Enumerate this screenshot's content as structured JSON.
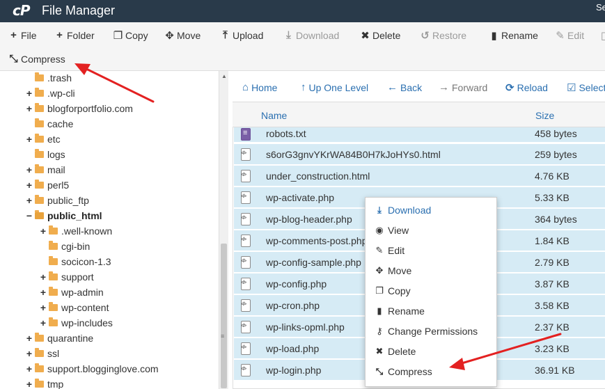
{
  "header": {
    "logo": "cP",
    "title": "File Manager",
    "right_text": "Se"
  },
  "toolbar": {
    "file": "File",
    "folder": "Folder",
    "copy": "Copy",
    "move": "Move",
    "upload": "Upload",
    "download": "Download",
    "delete": "Delete",
    "restore": "Restore",
    "rename": "Rename",
    "edit": "Edit",
    "compress": "Compress"
  },
  "tree": [
    {
      "label": ".trash",
      "expander": ""
    },
    {
      "label": ".wp-cli",
      "expander": "+"
    },
    {
      "label": "blogforportfolio.com",
      "expander": "+"
    },
    {
      "label": "cache",
      "expander": ""
    },
    {
      "label": "etc",
      "expander": "+"
    },
    {
      "label": "logs",
      "expander": ""
    },
    {
      "label": "mail",
      "expander": "+"
    },
    {
      "label": "perl5",
      "expander": "+"
    },
    {
      "label": "public_ftp",
      "expander": "+"
    },
    {
      "label": "public_html",
      "expander": "−"
    },
    {
      "label": ".well-known",
      "expander": "+"
    },
    {
      "label": "cgi-bin",
      "expander": ""
    },
    {
      "label": "socicon-1.3",
      "expander": ""
    },
    {
      "label": "support",
      "expander": "+"
    },
    {
      "label": "wp-admin",
      "expander": "+"
    },
    {
      "label": "wp-content",
      "expander": "+"
    },
    {
      "label": "wp-includes",
      "expander": "+"
    },
    {
      "label": "quarantine",
      "expander": "+"
    },
    {
      "label": "ssl",
      "expander": "+"
    },
    {
      "label": "support.blogginglove.com",
      "expander": "+"
    },
    {
      "label": "tmp",
      "expander": "+"
    }
  ],
  "nav": {
    "home": "Home",
    "up": "Up One Level",
    "back": "Back",
    "forward": "Forward",
    "reload": "Reload",
    "select_all": "Select All"
  },
  "columns": {
    "name": "Name",
    "size": "Size"
  },
  "files": [
    {
      "name": "robots.txt",
      "size": "458 bytes",
      "icon": "text-file-icon"
    },
    {
      "name": "s6orG3gnvYKrWA84B0H7kJoHYs0.html",
      "size": "259 bytes",
      "icon": "code-file-icon"
    },
    {
      "name": "under_construction.html",
      "size": "4.76 KB",
      "icon": "code-file-icon"
    },
    {
      "name": "wp-activate.php",
      "size": "5.33 KB",
      "icon": "code-file-icon"
    },
    {
      "name": "wp-blog-header.php",
      "size": "364 bytes",
      "icon": "code-file-icon"
    },
    {
      "name": "wp-comments-post.php",
      "size": "1.84 KB",
      "icon": "code-file-icon"
    },
    {
      "name": "wp-config-sample.php",
      "size": "2.79 KB",
      "icon": "code-file-icon"
    },
    {
      "name": "wp-config.php",
      "size": "3.87 KB",
      "icon": "code-file-icon"
    },
    {
      "name": "wp-cron.php",
      "size": "3.58 KB",
      "icon": "code-file-icon"
    },
    {
      "name": "wp-links-opml.php",
      "size": "2.37 KB",
      "icon": "code-file-icon"
    },
    {
      "name": "wp-load.php",
      "size": "3.23 KB",
      "icon": "code-file-icon"
    },
    {
      "name": "wp-login.php",
      "size": "36.91 KB",
      "icon": "code-file-icon"
    }
  ],
  "context_menu": {
    "download": "Download",
    "view": "View",
    "edit": "Edit",
    "move": "Move",
    "copy": "Copy",
    "rename": "Rename",
    "permissions": "Change Permissions",
    "delete": "Delete",
    "compress": "Compress"
  },
  "colors": {
    "header_bg": "#293a4a",
    "link_blue": "#2a6fb0",
    "selected_row": "#d6ebf5",
    "folder": "#f0ad4e",
    "annotation_arrow": "#e32121"
  }
}
